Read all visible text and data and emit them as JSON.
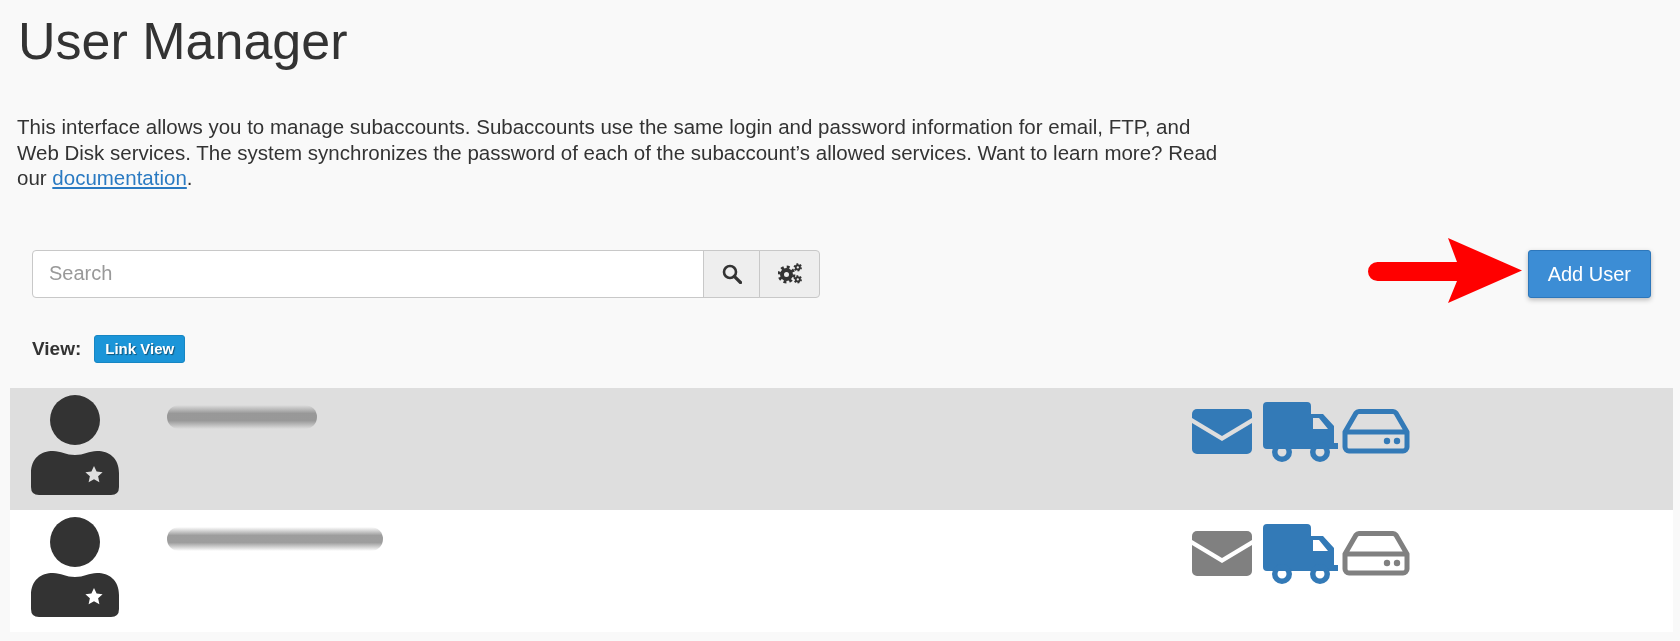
{
  "title": "User Manager",
  "description": {
    "text": "This interface allows you to manage subaccounts. Subaccounts use the same login and password information for email, FTP, and Web Disk services. The system synchronizes the password of each of the subaccount’s allowed services. Want to learn more? Read our ",
    "link": "documentation",
    "end": "."
  },
  "search": {
    "placeholder": "Search"
  },
  "add_button": "Add User",
  "view": {
    "label": "View:",
    "mode": "Link View"
  },
  "users": [
    {
      "selected": true,
      "services": [
        {
          "kind": "email",
          "enabled": true
        },
        {
          "kind": "ftp",
          "enabled": true
        },
        {
          "kind": "webdisk",
          "enabled": true
        }
      ]
    },
    {
      "selected": false,
      "services": [
        {
          "kind": "email",
          "enabled": false
        },
        {
          "kind": "ftp",
          "enabled": true
        },
        {
          "kind": "webdisk",
          "enabled": false
        }
      ]
    }
  ]
}
